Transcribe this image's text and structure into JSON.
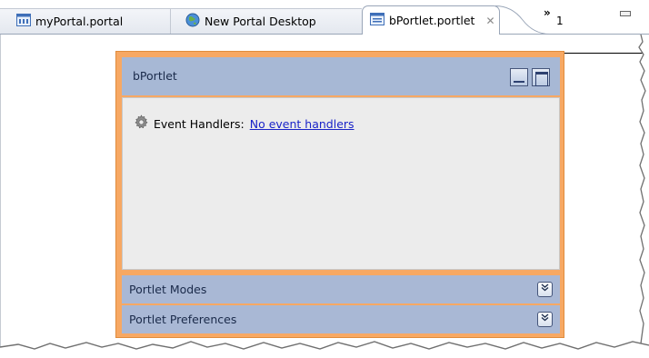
{
  "tabs": [
    {
      "label": "myPortal.portal",
      "icon": "portal-file-icon"
    },
    {
      "label": "New Portal Desktop",
      "icon": "globe-icon"
    },
    {
      "label": "bPortlet.portlet",
      "icon": "portlet-file-icon",
      "active": true
    }
  ],
  "overflow_tabs": {
    "chevron": "»",
    "count": "1"
  },
  "portlet": {
    "title": "bPortlet",
    "event_handlers_label": "Event Handlers:",
    "event_handlers_link": "No event handlers",
    "sections": [
      {
        "label": "Portlet Modes"
      },
      {
        "label": "Portlet Preferences"
      }
    ]
  },
  "colors": {
    "portlet_border": "#f7a863",
    "titlebar": "#a7b8d5",
    "content_bg": "#ececec",
    "link": "#1a24c8"
  }
}
